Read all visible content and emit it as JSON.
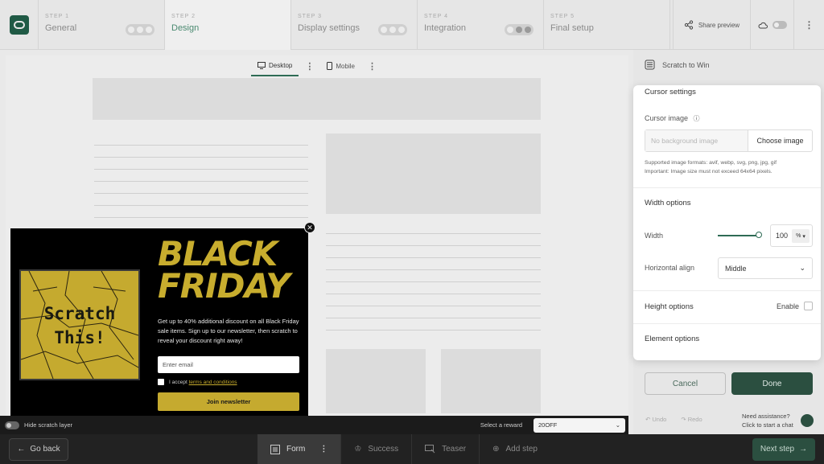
{
  "steps": [
    {
      "num": "STEP 1",
      "label": "General"
    },
    {
      "num": "STEP 2",
      "label": "Design"
    },
    {
      "num": "STEP 3",
      "label": "Display settings"
    },
    {
      "num": "STEP 4",
      "label": "Integration"
    },
    {
      "num": "STEP 5",
      "label": "Final setup"
    }
  ],
  "topbar": {
    "share_label": "Share preview"
  },
  "devices": {
    "desktop": "Desktop",
    "mobile": "Mobile"
  },
  "popup": {
    "scratch_text": "Scratch This!",
    "headline_1": "BLACK",
    "headline_2": "FRIDAY",
    "promo": "Get up to 40% additional discount on all Black Friday sale items. Sign up to our newsletter, then scratch to reveal your discount right away!",
    "email_placeholder": "Enter email",
    "accept_prefix": "I accept ",
    "accept_link": "terms and conditions",
    "join_label": "Join newsletter"
  },
  "scratchbar": {
    "hide_label": "Hide scratch layer",
    "reward_label": "Select a reward",
    "reward_value": "20OFF"
  },
  "bottombar": {
    "go_back": "Go back",
    "form": "Form",
    "success": "Success",
    "teaser": "Teaser",
    "add_step": "Add step",
    "next_step": "Next step"
  },
  "panel": {
    "title": "Scratch to Win",
    "cursor_settings": "Cursor settings",
    "cursor_image": "Cursor image",
    "image_placeholder": "No background image",
    "choose_image": "Choose image",
    "hint_1": "Supported image formats: avif, webp, svg, png, jpg, gif",
    "hint_2": "Important: Image size must not exceed 64x64 pixels.",
    "width_options": "Width options",
    "width_label": "Width",
    "width_value": "100",
    "width_unit": "%",
    "halign_label": "Horizontal align",
    "halign_value": "Middle",
    "height_options": "Height options",
    "enable_label": "Enable",
    "element_options": "Element options",
    "cancel": "Cancel",
    "done": "Done",
    "undo": "Undo",
    "redo": "Redo",
    "assist_1": "Need assistance?",
    "assist_2": "Click to start a chat"
  }
}
